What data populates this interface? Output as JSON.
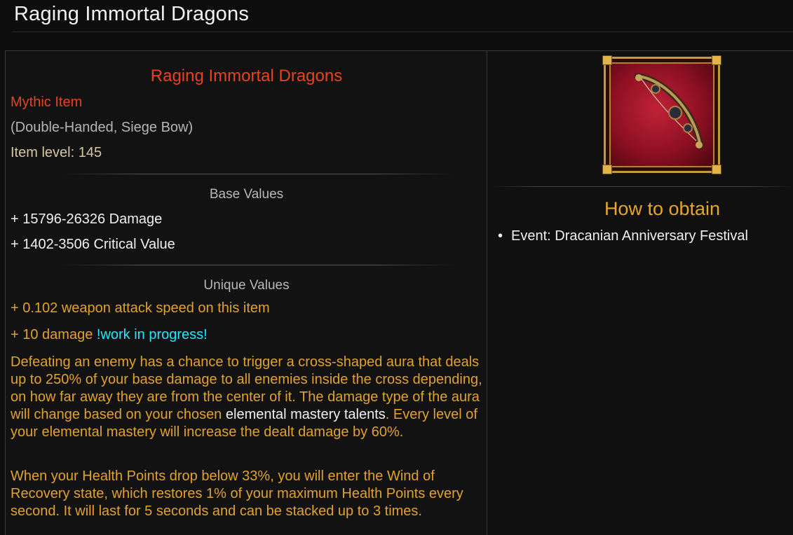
{
  "page": {
    "title": "Raging Immortal Dragons"
  },
  "item": {
    "name": "Raging Immortal Dragons",
    "rarity": "Mythic Item",
    "weapon_type": "(Double-Handed, Siege Bow)",
    "item_level": "Item level: 145",
    "base_values_heading": "Base Values",
    "base_values": [
      "+ 15796-26326 Damage",
      "+ 1402-3506 Critical Value"
    ],
    "unique_values_heading": "Unique Values",
    "unique_values": [
      "+ 0.102 weapon attack speed on this item",
      "+ 10 damage"
    ],
    "wip_note": "!work in progress!",
    "description_1a": "Defeating an enemy has a chance to trigger a cross-shaped aura that deals up to 250% of your base damage to all enemies inside the cross depending, on how far away they are from the center of it. The damage type of the aura will change based on your chosen ",
    "description_1_link": "elemental mastery talents",
    "description_1b": ". Every level of your elemental mastery will increase the dealt damage by 60%.",
    "description_2": "When your Health Points drop below 33%, you will enter the Wind of Recovery state, which restores 1% of your maximum Health Points every second. It will last for 5 seconds and can be stacked up to 3 times.",
    "icon": "siege-bow-icon"
  },
  "obtain": {
    "heading": "How to obtain",
    "sources": [
      "Event: Dracanian Anniversary Festival"
    ]
  },
  "colors": {
    "mythic": "#e8421f",
    "unique": "#e2a22c",
    "wip": "#1fe8ff",
    "heading_gold": "#e6a62a"
  }
}
